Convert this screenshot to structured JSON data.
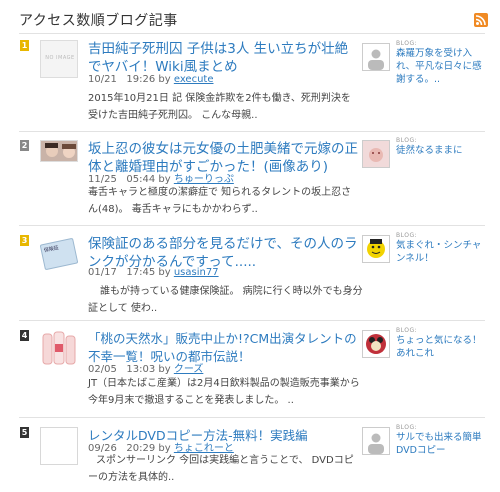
{
  "header": {
    "title": "アクセス数順ブログ記事",
    "feed_icon": "rss-icon"
  },
  "colors": {
    "link": "#2d7bbf",
    "rank_gold": "#e8b700",
    "rank_gray": "#888888",
    "rank_dark": "#333333",
    "rss": "#f08a24"
  },
  "entries": [
    {
      "rank": "1",
      "thumb_text": "NO IMAGE",
      "title": "吉田純子死刑囚 子供は3人 生い立ちが壮絶でヤバイ！Wiki風まとめ",
      "date": "10/21",
      "time": "19:26",
      "by": "by",
      "author": "execute",
      "excerpt": "2015年10月21日 記 保険金詐欺を2件も働き、死刑判決を受けた吉田純子死刑囚。 こんな母親..",
      "blog_label": "BLOG:",
      "blog_name": "森羅万象を受け入れ、平凡な日々に感謝する。.."
    },
    {
      "rank": "2",
      "title": "坂上忍の彼女は元女優の土肥美緒で元嫁の正体と離婚理由がすごかった！(画像あり)",
      "date": "11/25",
      "time": "05:44",
      "by": "by",
      "author": "ちゅーりっぷ",
      "excerpt": "毒舌キャラと極度の潔癖症で 知られるタレントの坂上忍さん(48)。 毒舌キャラにもかかわらず..",
      "blog_label": "BLOG:",
      "blog_name": "徒然なるままに"
    },
    {
      "rank": "3",
      "thumb_text": "保険証",
      "title": "保険証のある部分を見るだけで、その人のランクが分かるんですって.....",
      "date": "01/17",
      "time": "17:45",
      "by": "by",
      "author": "usasin77",
      "excerpt": "誰もが持っている健康保険証。 病院に行く時以外でも身分証として 使わ..",
      "blog_label": "BLOG:",
      "blog_name": "気まぐれ・シンチャンネル！"
    },
    {
      "rank": "4",
      "title": "「桃の天然水」販売中止か!?CM出演タレントの不幸一覧！呪いの都市伝説！",
      "date": "02/05",
      "time": "13:03",
      "by": "by",
      "author": "クーズ",
      "excerpt": "JT（日本たばこ産業）は2月4日飲料製品の製造販売事業から今年9月末で撤退することを発表しました。 ..",
      "blog_label": "BLOG:",
      "blog_name": "ちょっと気になる！あれこれ"
    },
    {
      "rank": "5",
      "title": "レンタルDVDコピー方法-無料！実践編",
      "date": "09/26",
      "time": "20:29",
      "by": "by",
      "author": "ちょこれーと",
      "excerpt": "スポンサーリンク 今回は実践編と言うことで、 DVDコピーの方法を具体的..",
      "blog_label": "BLOG:",
      "blog_name": "サルでも出来る簡単DVDコピー"
    }
  ]
}
